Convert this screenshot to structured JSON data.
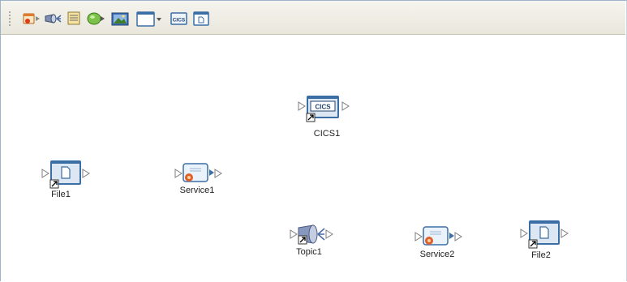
{
  "toolbar": {
    "buttons": [
      {
        "name": "file-tool",
        "icon": "file-adapter-icon"
      },
      {
        "name": "topic-tool",
        "icon": "topic-icon"
      },
      {
        "name": "queue-tool",
        "icon": "queue-icon"
      },
      {
        "name": "service-tool",
        "icon": "service-icon"
      },
      {
        "name": "image-tool",
        "icon": "image-icon"
      },
      {
        "name": "window-dropdown",
        "icon": "window-dropdown-icon"
      },
      {
        "name": "cics-tool",
        "icon": "cics-icon",
        "text": "CICS"
      },
      {
        "name": "file-window-tool",
        "icon": "file-window-icon"
      }
    ]
  },
  "canvas": {
    "nodes": [
      {
        "id": "cics1",
        "label": "CICS1",
        "type": "cics",
        "icon_text": "CICS"
      },
      {
        "id": "file1",
        "label": "File1",
        "type": "file"
      },
      {
        "id": "service1",
        "label": "Service1",
        "type": "service"
      },
      {
        "id": "topic1",
        "label": "Topic1",
        "type": "topic"
      },
      {
        "id": "service2",
        "label": "Service2",
        "type": "service"
      },
      {
        "id": "file2",
        "label": "File2",
        "type": "file"
      }
    ]
  },
  "colors": {
    "toolbar_bg": "#ecebe3",
    "frame_border": "#9db3cc",
    "node_window_blue": "#3a6ea5",
    "arrow_gray": "#9a9a9a",
    "service_gear": "#e0602a"
  }
}
